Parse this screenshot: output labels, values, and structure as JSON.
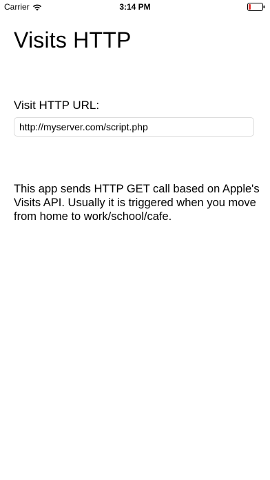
{
  "status_bar": {
    "carrier": "Carrier",
    "time": "3:14 PM",
    "battery_color": "#e53935",
    "icons": [
      "wifi-icon",
      "battery-icon"
    ]
  },
  "main": {
    "title": "Visits HTTP",
    "url_label": "Visit HTTP URL:",
    "url_value": "http://myserver.com/script.php",
    "description": "This app sends HTTP GET call based on Apple's Visits API. Usually it is triggered when you move from home to work/school/cafe."
  }
}
